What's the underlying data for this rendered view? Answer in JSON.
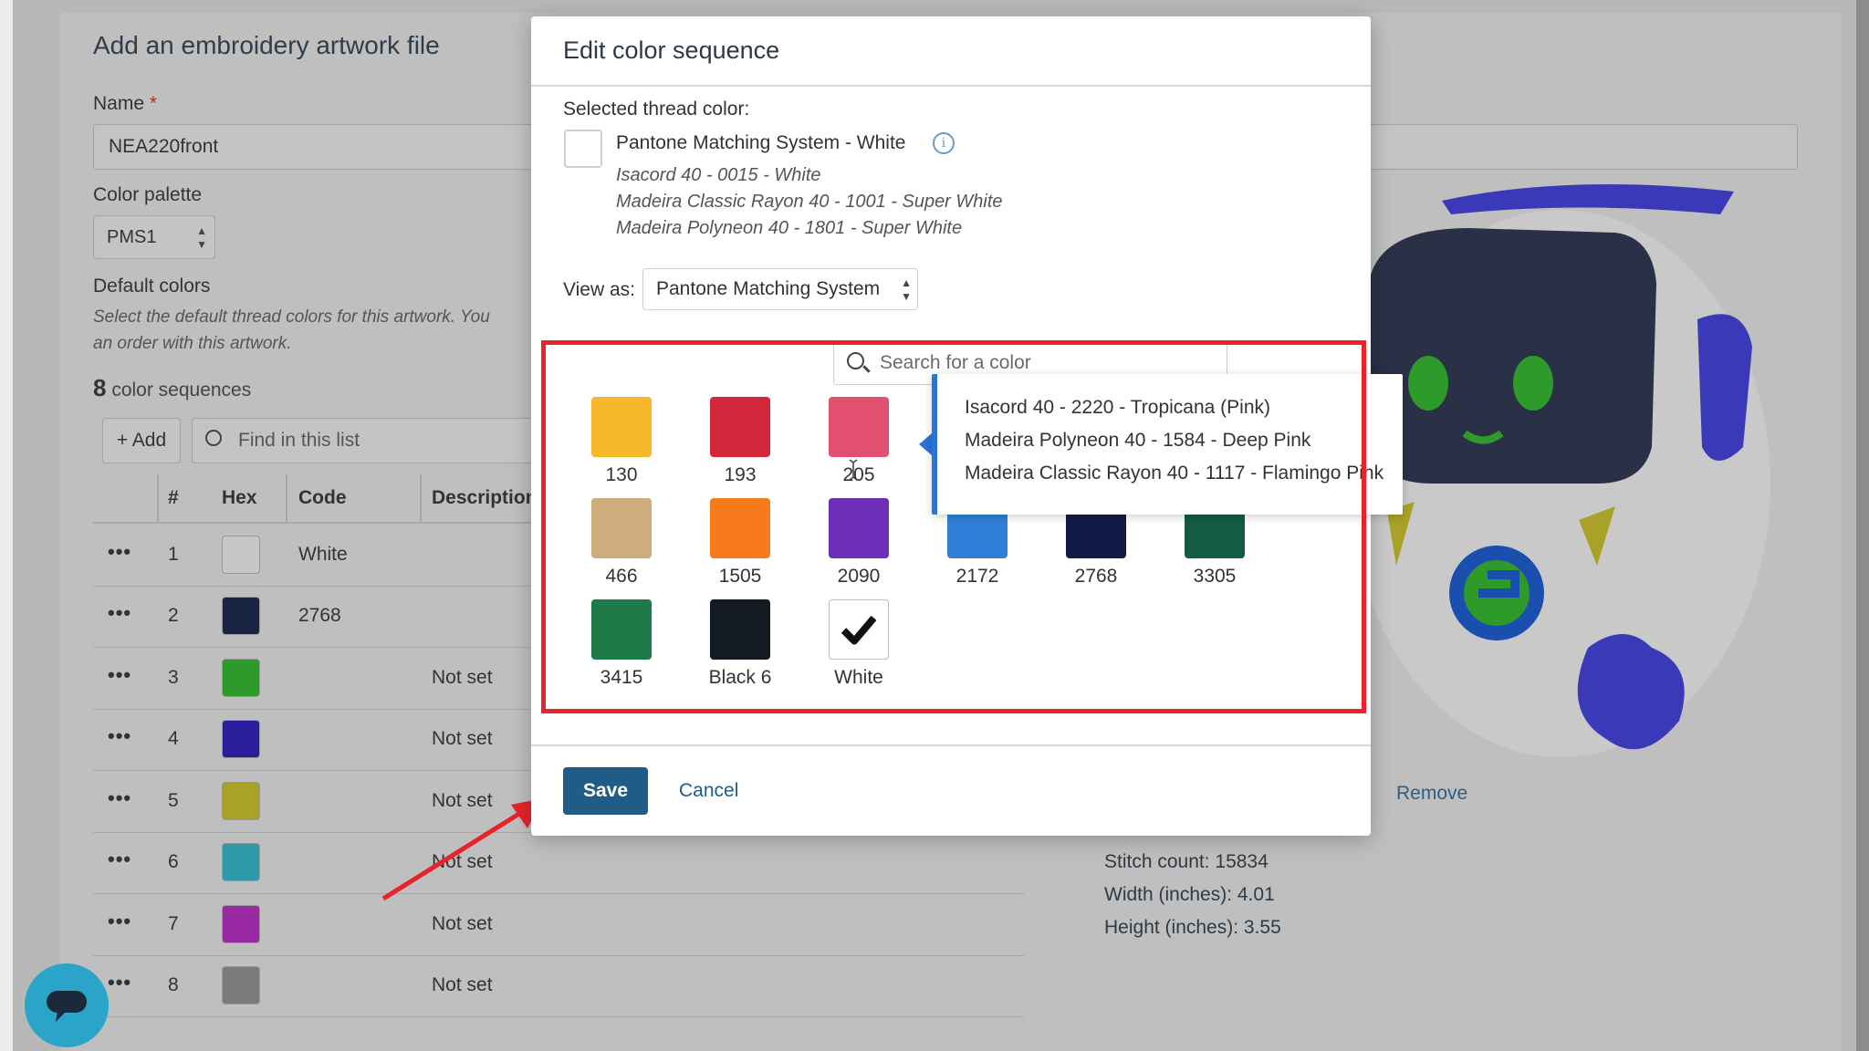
{
  "background_page": {
    "heading": "Add an embroidery artwork file",
    "name_label": "Name",
    "required_mark": "*",
    "name_value": "NEA220front",
    "palette_label": "Color palette",
    "palette_value": "PMS1",
    "default_colors_label": "Default colors",
    "default_colors_help_1": "Select the default thread colors for this artwork. You",
    "default_colors_help_2": "an order with this artwork.",
    "sequences_count": "8",
    "sequences_label": "color sequences",
    "add_button": "+ Add",
    "find_placeholder": "Find in this list",
    "columns": [
      "#",
      "Hex",
      "Code",
      "Description"
    ],
    "rows": [
      {
        "menu": "•••",
        "num": "1",
        "color": "#c6c6c6",
        "code": "White",
        "desc": ""
      },
      {
        "menu": "•••",
        "num": "2",
        "color": "#1a2340",
        "code": "2768",
        "desc": ""
      },
      {
        "menu": "•••",
        "num": "3",
        "color": "#2e9a2a",
        "code": "",
        "desc": "Not set"
      },
      {
        "menu": "•••",
        "num": "4",
        "color": "#2a1e9c",
        "code": "",
        "desc": "Not set"
      },
      {
        "menu": "•••",
        "num": "5",
        "color": "#a8a228",
        "code": "",
        "desc": "Not set"
      },
      {
        "menu": "•••",
        "num": "6",
        "color": "#2e9aa8",
        "code": "",
        "desc": "Not set"
      },
      {
        "menu": "•••",
        "num": "7",
        "color": "#9a2aa2",
        "code": "",
        "desc": "Not set"
      },
      {
        "menu": "•••",
        "num": "8",
        "color": "#7a7a7a",
        "code": "",
        "desc": "Not set"
      }
    ],
    "remove_link": "Remove",
    "stitch_count": "Stitch count: 15834",
    "width": "Width (inches): 4.01",
    "height": "Height (inches): 3.55"
  },
  "modal": {
    "title": "Edit color sequence",
    "selected_label": "Selected thread color:",
    "selected_name": "Pantone Matching System - White",
    "info_icon": "info-icon",
    "equivalents": [
      "Isacord 40 - 0015 - White",
      "Madeira Classic Rayon 40 - 1001 - Super White",
      "Madeira Polyneon 40 - 1801 - Super White"
    ],
    "view_as_label": "View as:",
    "view_as_value": "Pantone Matching System",
    "search_placeholder": "Search for a color",
    "colors": [
      {
        "label": "130",
        "hex": "#f6b72b"
      },
      {
        "label": "193",
        "hex": "#d0283a"
      },
      {
        "label": "205",
        "hex": "#e2506f"
      },
      {
        "label": "",
        "hex": "#f4c4c4"
      },
      {
        "label": "",
        "hex": "#d6e6f6"
      },
      {
        "label": "",
        "hex": "#eeeeee"
      },
      {
        "label": "466",
        "hex": "#ccad7b"
      },
      {
        "label": "1505",
        "hex": "#f77a1d"
      },
      {
        "label": "2090",
        "hex": "#6e2fb8"
      },
      {
        "label": "2172",
        "hex": "#2f7fd7"
      },
      {
        "label": "2768",
        "hex": "#121b45"
      },
      {
        "label": "3305",
        "hex": "#135b43"
      },
      {
        "label": "3415",
        "hex": "#1f7a48"
      },
      {
        "label": "Black 6",
        "hex": "#131a22"
      },
      {
        "label": "White",
        "hex": "#ffffff"
      }
    ],
    "tooltip_lines": [
      "Isacord 40 - 2220 - Tropicana (Pink)",
      "Madeira Polyneon 40 - 1584 - Deep Pink",
      "Madeira Classic Rayon 40 - 1117 - Flamingo Pink"
    ],
    "save_label": "Save",
    "cancel_label": "Cancel",
    "highlight_color": "#e8242a"
  },
  "chat_icon": "chat-bubble-icon"
}
